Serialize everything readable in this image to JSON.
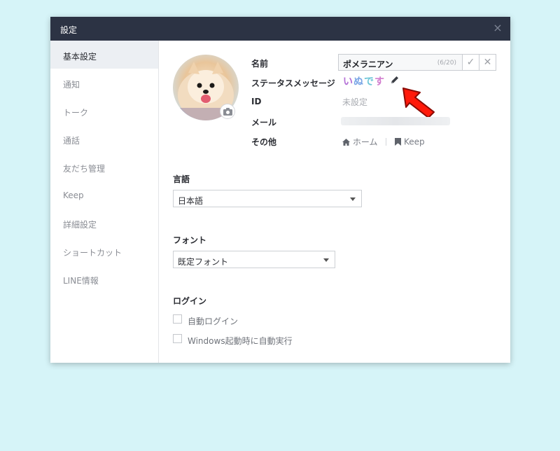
{
  "window": {
    "title": "設定",
    "close_glyph": "×"
  },
  "sidebar": {
    "items": [
      {
        "label": "基本設定",
        "active": true
      },
      {
        "label": "通知"
      },
      {
        "label": "トーク"
      },
      {
        "label": "通話"
      },
      {
        "label": "友だち管理"
      },
      {
        "label": "Keep"
      },
      {
        "label": "詳細設定"
      },
      {
        "label": "ショートカット"
      },
      {
        "label": "LINE情報"
      }
    ]
  },
  "profile": {
    "labels": {
      "name": "名前",
      "status": "ステータスメッセージ",
      "id": "ID",
      "mail": "メール",
      "other": "その他"
    },
    "name_value": "ポメラニアン",
    "name_count": "(6/20)",
    "confirm_glyph": "✓",
    "cancel_glyph": "✕",
    "status_chars": [
      "い",
      "ぬ",
      "で",
      "す"
    ],
    "id_value": "未設定",
    "links": {
      "home": "ホーム",
      "keep": "Keep"
    }
  },
  "language": {
    "heading": "言語",
    "selected": "日本語"
  },
  "font": {
    "heading": "フォント",
    "selected": "既定フォント"
  },
  "login": {
    "heading": "ログイン",
    "options": [
      {
        "label": "自動ログイン",
        "checked": false
      },
      {
        "label": "Windows起動時に自動実行",
        "checked": false
      }
    ]
  },
  "colors": {
    "titlebar": "#2c3344",
    "background": "#d6f4f8",
    "arrow": "#ff1a0a",
    "sidebar_active": "#eceff3"
  }
}
